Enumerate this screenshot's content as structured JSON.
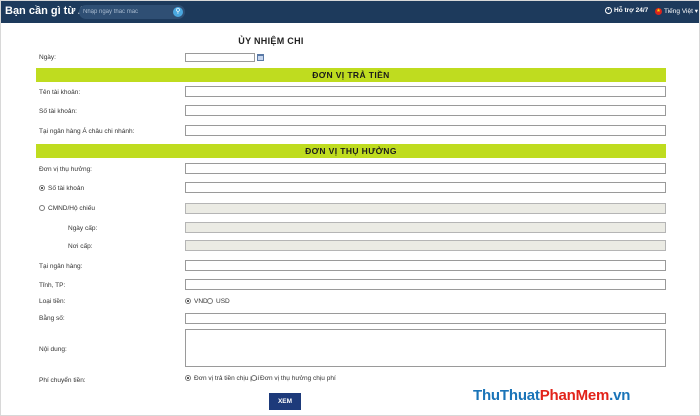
{
  "topbar": {
    "question": "Bạn cần gì từ ACB?",
    "search_placeholder": "Nhập ngay thắc mắc",
    "support": "Hỗ trợ 24/7",
    "language": "Tiếng Việt"
  },
  "form": {
    "title": "ỦY NHIỆM CHI",
    "date_label": "Ngày:",
    "payer": {
      "heading": "ĐƠN VỊ TRẢ TIỀN",
      "account_name_label": "Tên tài khoản:",
      "account_number_label": "Số tài khoản:",
      "branch_label": "Tại ngân hàng Á châu chi nhánh:"
    },
    "beneficiary": {
      "heading": "ĐƠN VỊ THỤ HƯỞNG",
      "unit_label": "Đơn vị thụ hưởng:",
      "account_option_label": "Số tài khoản",
      "id_option_label": "CMND/Hộ chiếu",
      "issue_date_label": "Ngày cấp:",
      "issue_place_label": "Nơi cấp:",
      "bank_label": "Tại ngân hàng:",
      "province_label": "Tỉnh, TP:",
      "currency_label": "Loại tiền:",
      "currency_vnd": "VND",
      "currency_usd": "USD",
      "in_words_label": "Bằng số:",
      "content_label": "Nội dung:",
      "fee_label": "Phí chuyển tiền:",
      "fee_payer": "Đơn vị trả tiền chịu phí",
      "fee_beneficiary": "Đơn vị thụ hưởng chịu phí"
    },
    "submit": "XEM"
  },
  "watermark": {
    "part1": "ThuThuat",
    "part2": "PhanMem",
    "part3": ".vn"
  }
}
